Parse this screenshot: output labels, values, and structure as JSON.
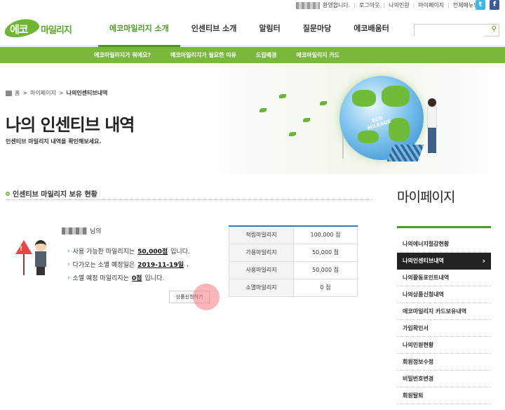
{
  "util": {
    "greeting": "환영합니다.",
    "links": [
      "로그아웃",
      "나의민원",
      "마이페이지",
      "전체메뉴보기"
    ],
    "twitter": "t",
    "facebook": "f"
  },
  "logo": {
    "part1": "에코",
    "part2": "마일리지"
  },
  "gnb": [
    "에코마일리지 소개",
    "인센티브 소개",
    "알림터",
    "질문마당",
    "에코배움터"
  ],
  "subnav": [
    "에코마일리지가 뭐에요?",
    "에코마일리지가 필요한 이유",
    "도입배경",
    "에코마일리지 카드"
  ],
  "breadcrumb": {
    "home": "홈",
    "parent": "마이페이지",
    "current": "나의인센티브내역"
  },
  "hero": {
    "title": "나의 인센티브 내역",
    "desc": "인센티브 마일리지 내역을 확인해보세요.",
    "globe_label_1": "ECO",
    "globe_label_2": "MILEAGE"
  },
  "section": {
    "title": "인센티브 마일리지 보유 현황"
  },
  "user": {
    "suffix": "님의",
    "line1_pre": "사용 가능한 마일리지는",
    "line1_val": "50,000점",
    "line1_post": "입니다.",
    "line2_pre": "다가오는 소멸 예정일은",
    "line2_val": "2019-11-19일",
    "line3_pre": "소멸 예정 마일리지는",
    "line3_val": "0점",
    "line3_post": "입니다."
  },
  "apply_button": "상품신청하기",
  "table": [
    {
      "k": "적립마일리지",
      "v": "100,000 점"
    },
    {
      "k": "가용마일리지",
      "v": "50,000 점"
    },
    {
      "k": "사용마일리지",
      "v": "50,000 점"
    },
    {
      "k": "소멸마일리지",
      "v": "0 점"
    }
  ],
  "sidebar": {
    "title": "마이페이지",
    "items": [
      "나의에너지절감현황",
      "나의인센티브내역",
      "나의활동포인트내역",
      "나의상품신청내역",
      "에코마일리지 카드보유내역",
      "가입확인서",
      "나의민원현황",
      "회원정보수정",
      "비밀번호변경",
      "회원탈퇴"
    ]
  }
}
